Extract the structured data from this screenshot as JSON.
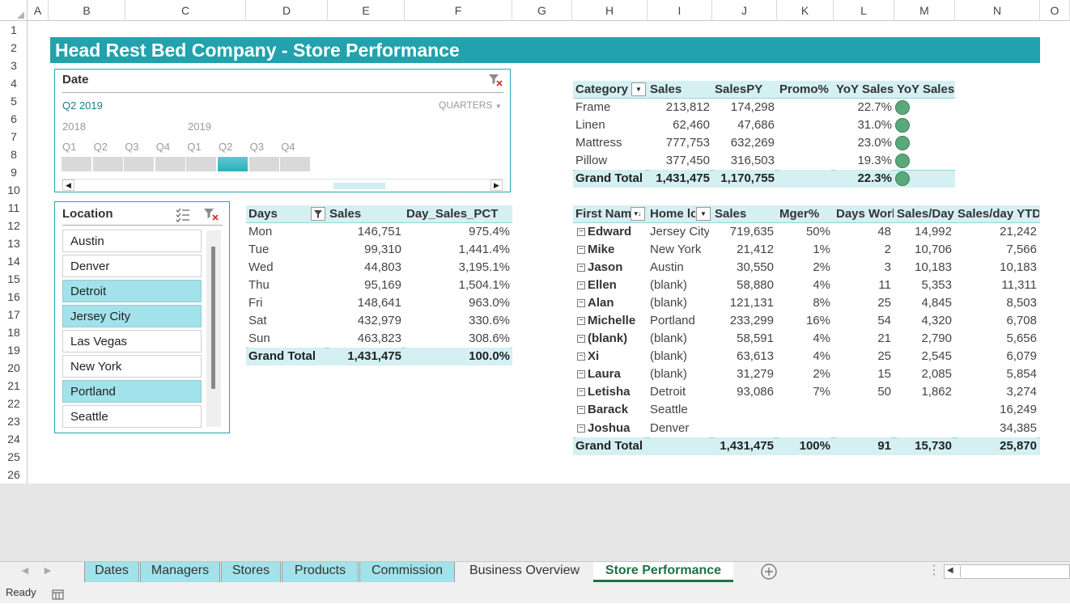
{
  "columns": [
    "A",
    "B",
    "C",
    "D",
    "E",
    "F",
    "G",
    "H",
    "I",
    "J",
    "K",
    "L",
    "M",
    "N",
    "O"
  ],
  "rows": [
    "1",
    "2",
    "3",
    "4",
    "5",
    "6",
    "7",
    "8",
    "9",
    "10",
    "11",
    "12",
    "13",
    "14",
    "15",
    "16",
    "17",
    "18",
    "19",
    "20",
    "21",
    "22",
    "23",
    "24",
    "25",
    "26"
  ],
  "banner": "Head Rest Bed Company - Store Performance",
  "date_slicer": {
    "title": "Date",
    "selection": "Q2 2019",
    "level": "QUARTERS",
    "years": [
      "2018",
      "2019"
    ],
    "quarters": [
      "Q1",
      "Q2",
      "Q3",
      "Q4",
      "Q1",
      "Q2",
      "Q3",
      "Q4"
    ],
    "selected_index": 5,
    "icons": {
      "clear": "clear-filter-icon",
      "dropdown": "chevron-down-icon",
      "scroll_left": "scroll-left-icon",
      "scroll_right": "scroll-right-icon"
    }
  },
  "location_slicer": {
    "title": "Location",
    "items": [
      {
        "label": "Austin",
        "selected": false
      },
      {
        "label": "Denver",
        "selected": false
      },
      {
        "label": "Detroit",
        "selected": true
      },
      {
        "label": "Jersey City",
        "selected": true
      },
      {
        "label": "Las Vegas",
        "selected": false
      },
      {
        "label": "New York",
        "selected": false
      },
      {
        "label": "Portland",
        "selected": true
      },
      {
        "label": "Seattle",
        "selected": false
      }
    ],
    "icons": {
      "multiselect": "multi-select-icon",
      "clear": "clear-filter-icon"
    }
  },
  "days_table": {
    "headers": [
      "Days",
      "Sales",
      "Day_Sales_PCT"
    ],
    "rows": [
      [
        "Mon",
        "146,751",
        "975.4%"
      ],
      [
        "Tue",
        "99,310",
        "1,441.4%"
      ],
      [
        "Wed",
        "44,803",
        "3,195.1%"
      ],
      [
        "Thu",
        "95,169",
        "1,504.1%"
      ],
      [
        "Fri",
        "148,641",
        "963.0%"
      ],
      [
        "Sat",
        "432,979",
        "330.6%"
      ],
      [
        "Sun",
        "463,823",
        "308.6%"
      ]
    ],
    "total": [
      "Grand Total",
      "1,431,475",
      "100.0%"
    ]
  },
  "category_table": {
    "headers": [
      "Category",
      "Sales",
      "SalesPY",
      "Promo%",
      "YoY Sales",
      "YoY Sales"
    ],
    "rows": [
      [
        "Frame",
        "213,812",
        "174,298",
        "",
        "22.7%"
      ],
      [
        "Linen",
        "62,460",
        "47,686",
        "",
        "31.0%"
      ],
      [
        "Mattress",
        "777,753",
        "632,269",
        "",
        "23.0%"
      ],
      [
        "Pillow",
        "377,450",
        "316,503",
        "",
        "19.3%"
      ]
    ],
    "total": [
      "Grand Total",
      "1,431,475",
      "1,170,755",
      "",
      "22.3%"
    ],
    "indicator_color": "#5aa97d"
  },
  "manager_table": {
    "headers": [
      "First Nam",
      "Home lo",
      "Sales",
      "Mger%",
      "Days Worl",
      "Sales/Day",
      "Sales/day YTD"
    ],
    "rows": [
      [
        "Edward",
        "Jersey City",
        "719,635",
        "50%",
        "48",
        "14,992",
        "21,242"
      ],
      [
        "Mike",
        "New York",
        "21,412",
        "1%",
        "2",
        "10,706",
        "7,566"
      ],
      [
        "Jason",
        "Austin",
        "30,550",
        "2%",
        "3",
        "10,183",
        "10,183"
      ],
      [
        "Ellen",
        "(blank)",
        "58,880",
        "4%",
        "11",
        "5,353",
        "11,311"
      ],
      [
        "Alan",
        "(blank)",
        "121,131",
        "8%",
        "25",
        "4,845",
        "8,503"
      ],
      [
        "Michelle",
        "Portland",
        "233,299",
        "16%",
        "54",
        "4,320",
        "6,708"
      ],
      [
        "(blank)",
        "(blank)",
        "58,591",
        "4%",
        "21",
        "2,790",
        "5,656"
      ],
      [
        "Xi",
        "(blank)",
        "63,613",
        "4%",
        "25",
        "2,545",
        "6,079"
      ],
      [
        "Laura",
        "(blank)",
        "31,279",
        "2%",
        "15",
        "2,085",
        "5,854"
      ],
      [
        "Letisha",
        "Detroit",
        "93,086",
        "7%",
        "50",
        "1,862",
        "3,274"
      ],
      [
        "Barack",
        "Seattle",
        "",
        "",
        "",
        "",
        "16,249"
      ],
      [
        "Joshua",
        "Denver",
        "",
        "",
        "",
        "",
        "34,385"
      ]
    ],
    "total": [
      "Grand Total",
      "",
      "1,431,475",
      "100%",
      "91",
      "15,730",
      "25,870"
    ]
  },
  "sheet_tabs": [
    "Dates",
    "Managers",
    "Stores",
    "Products",
    "Commission",
    "Business Overview",
    "Store Performance"
  ],
  "active_tab": "Store Performance",
  "status": "Ready",
  "accent": "#21a2ad"
}
